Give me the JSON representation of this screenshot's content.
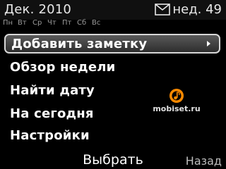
{
  "header": {
    "month_title": "Дек. 2010",
    "week_label": "нед. 49",
    "message_icon": "envelope-icon"
  },
  "weekdays": [
    "Пн",
    "Вт",
    "Ср",
    "Чт",
    "Пт",
    "Сб",
    "Вс"
  ],
  "menu": {
    "items": [
      {
        "label": "Добавить заметку",
        "has_submenu": true
      },
      {
        "label": "Обзор недели"
      },
      {
        "label": "Найти дату"
      },
      {
        "label": "На сегодня"
      },
      {
        "label": "Настройки"
      }
    ],
    "selected_index": 0,
    "submenu_icon": "triangle-right-icon"
  },
  "softkeys": {
    "center": "Выбрать",
    "right": "Назад"
  },
  "watermark": {
    "text": "mobiset.ru"
  },
  "colors": {
    "background": "#000000",
    "selection_border": "#d8d8d8",
    "watermark_logo": "#ff8a00"
  }
}
